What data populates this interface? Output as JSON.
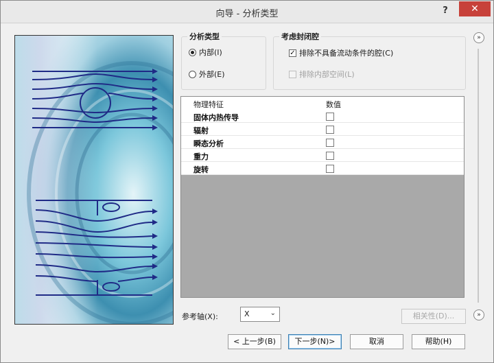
{
  "window": {
    "title": "向导 - 分析类型",
    "help_label": "?",
    "close_label": "✕"
  },
  "analysis_type": {
    "title": "分析类型",
    "options": [
      {
        "label": "内部(I)",
        "selected": true
      },
      {
        "label": "外部(E)",
        "selected": false
      }
    ]
  },
  "closed_cavity": {
    "title": "考虑封闭腔",
    "options": [
      {
        "label": "排除不具备流动条件的腔(C)",
        "checked": true,
        "enabled": true
      },
      {
        "label": "排除内部空间(L)",
        "checked": false,
        "enabled": false
      }
    ]
  },
  "physics_table": {
    "headers": [
      "物理特征",
      "数值"
    ],
    "rows": [
      {
        "label": "固体内热传导",
        "checked": false
      },
      {
        "label": "辐射",
        "checked": false
      },
      {
        "label": "瞬态分析",
        "checked": false
      },
      {
        "label": "重力",
        "checked": false
      },
      {
        "label": "旋转",
        "checked": false
      }
    ]
  },
  "reference_axis": {
    "label": "参考轴(X):",
    "value": "X"
  },
  "buttons": {
    "dependency": "相关性(D)...",
    "back": "< 上一步(B)",
    "next": "下一步(N)>",
    "cancel": "取消",
    "help": "帮助(H)"
  },
  "side_buttons": {
    "expand_top": "»",
    "expand_bottom": "»"
  },
  "colors": {
    "close": "#c7413a",
    "illustration_bg": "#a9dbe6",
    "flow_lines": "#1f2a86",
    "table_empty": "#a9a9a9"
  }
}
